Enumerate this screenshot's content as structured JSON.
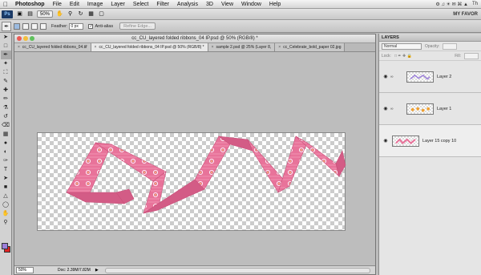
{
  "menubar": {
    "items": [
      "Photoshop",
      "File",
      "Edit",
      "Image",
      "Layer",
      "Select",
      "Filter",
      "Analysis",
      "3D",
      "View",
      "Window",
      "Help"
    ],
    "right": "Th"
  },
  "appbar": {
    "zoom": "50%",
    "workspace": "MY FAVOR"
  },
  "options": {
    "feather_label": "Feather:",
    "feather_value": "0 px",
    "antialias_label": "Anti-alias",
    "refine_edge": "Refine Edge..."
  },
  "document": {
    "title": "cc_CU_layered folded ribbons_04 IP.psd @ 50% (RGB/8) *",
    "tabs": [
      {
        "label": "cc_CU_layered folded ribbons_04.tif",
        "active": false
      },
      {
        "label": "cc_CU_layered folded ribbons_04 IP.psd @ 50% (RGB/8) *",
        "active": true
      },
      {
        "label": "sample 2.psd @ 25% (Layer 8,",
        "active": false
      },
      {
        "label": "cc_Celebrate_bold_paper 02.jpg",
        "active": false
      }
    ],
    "status_zoom": "50%",
    "status_doc": "Doc: 2.39M/7.82M"
  },
  "layers": {
    "panel_title": "LAYERS",
    "blend_mode": "Normal",
    "opacity_label": "Opacity:",
    "lock_label": "Lock:",
    "fill_label": "Fill:",
    "items": [
      {
        "name": "Layer 2",
        "thumb": "purple"
      },
      {
        "name": "Layer 1",
        "thumb": "orange"
      },
      {
        "name": "Layer 15 copy 10",
        "thumb": "pink"
      }
    ]
  },
  "colors": {
    "ribbon": "#e8739a",
    "ribbon_dark": "#c9507a",
    "foreground": "#9b7fd9",
    "background": "#e02424"
  }
}
